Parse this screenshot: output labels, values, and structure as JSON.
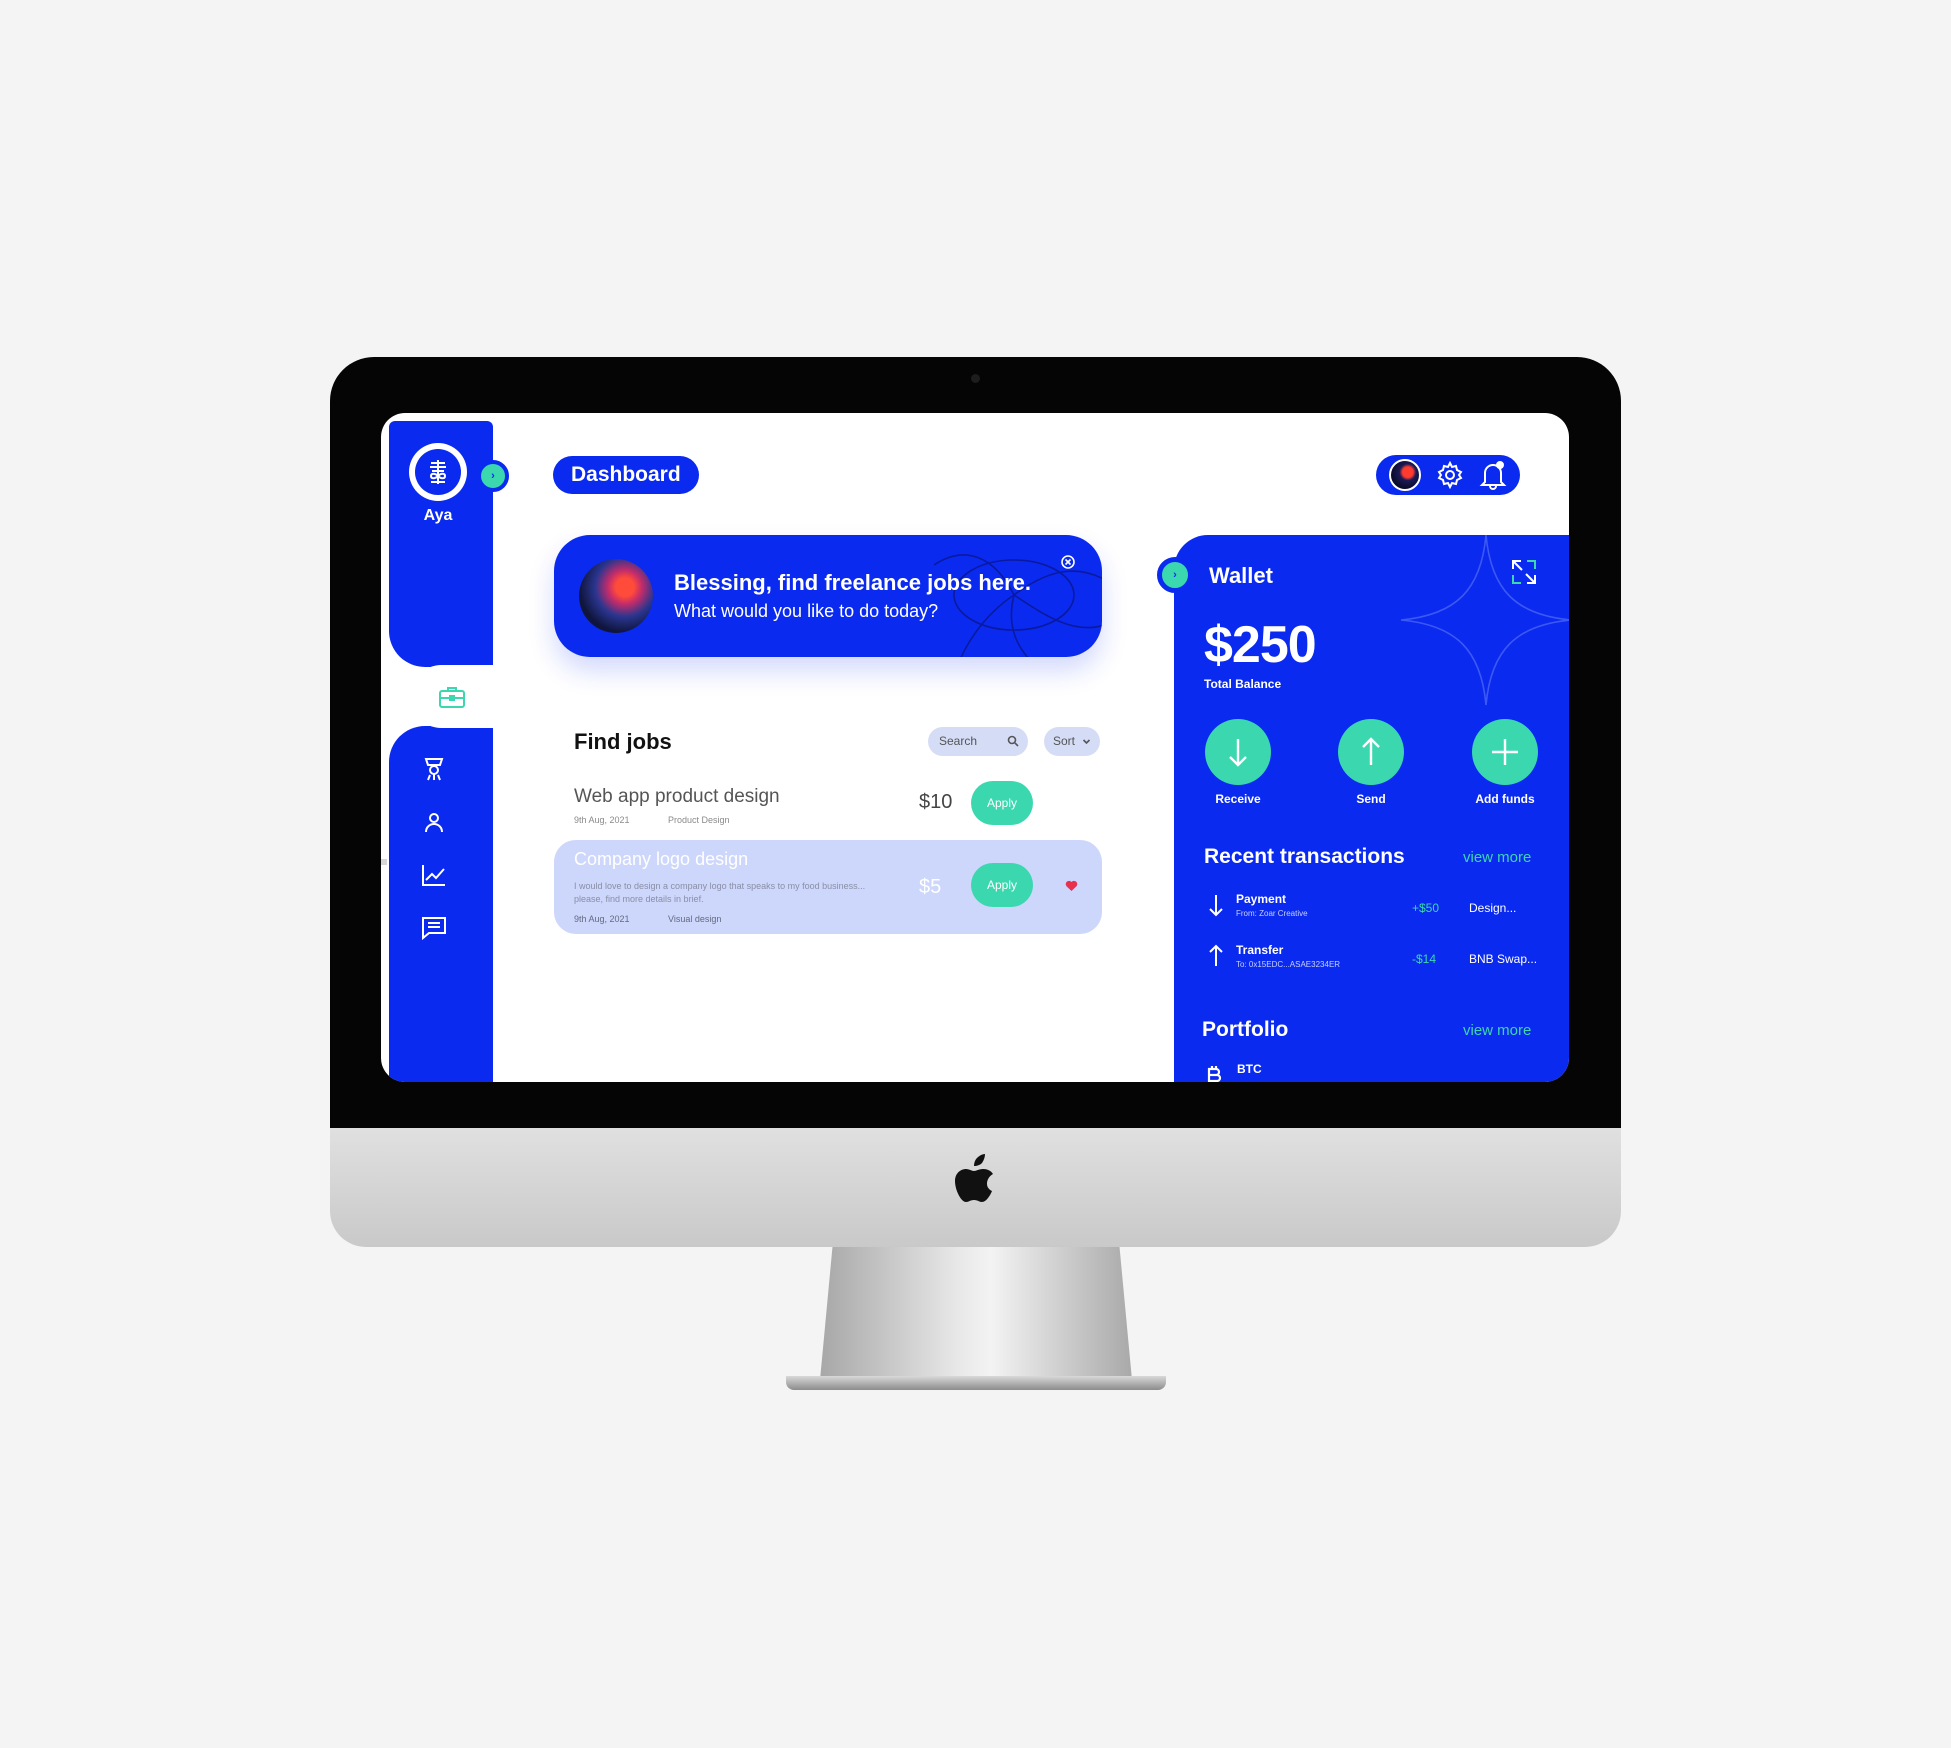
{
  "sidebar": {
    "app_name": "Aya",
    "nav": [
      "jobs-icon",
      "trophy-icon",
      "profile-icon",
      "analytics-icon",
      "messages-icon"
    ]
  },
  "header": {
    "title": "Dashboard",
    "icons": [
      "user-avatar",
      "gear-icon",
      "bell-icon"
    ]
  },
  "banner": {
    "title": "Blessing, find freelance jobs here.",
    "subtitle": "What would you like to do today?"
  },
  "jobs": {
    "title": "Find jobs",
    "search_label": "Search",
    "sort_label": "Sort",
    "items": [
      {
        "title": "Web app product design",
        "date": "9th Aug, 2021",
        "category": "Product Design",
        "price": "$10",
        "apply": "Apply"
      },
      {
        "title": "Company logo design",
        "description": "I would love to design a company logo that speaks to my food business... please, find more details in brief.",
        "date": "9th Aug, 2021",
        "category": "Visual design",
        "price": "$5",
        "apply": "Apply"
      }
    ]
  },
  "wallet": {
    "title": "Wallet",
    "balance": "$250",
    "balance_label": "Total Balance",
    "actions": [
      {
        "label": "Receive"
      },
      {
        "label": "Send"
      },
      {
        "label": "Add funds"
      }
    ],
    "recent_title": "Recent transactions",
    "view_more": "view more",
    "transactions": [
      {
        "name": "Payment",
        "sub": "From: Zoar Creative",
        "amount": "+$50",
        "desc": "Design..."
      },
      {
        "name": "Transfer",
        "sub": "To: 0x15EDC...ASAE3234ER",
        "amount": "-$14",
        "desc": "BNB Swap..."
      }
    ],
    "portfolio_title": "Portfolio",
    "portfolio_view_more": "view more",
    "portfolio": [
      {
        "symbol": "BTC"
      }
    ]
  },
  "colors": {
    "primary": "#0a2af0",
    "accent": "#3bd8b0",
    "job_highlight": "#cdd6fb",
    "heart": "#e8314f"
  }
}
